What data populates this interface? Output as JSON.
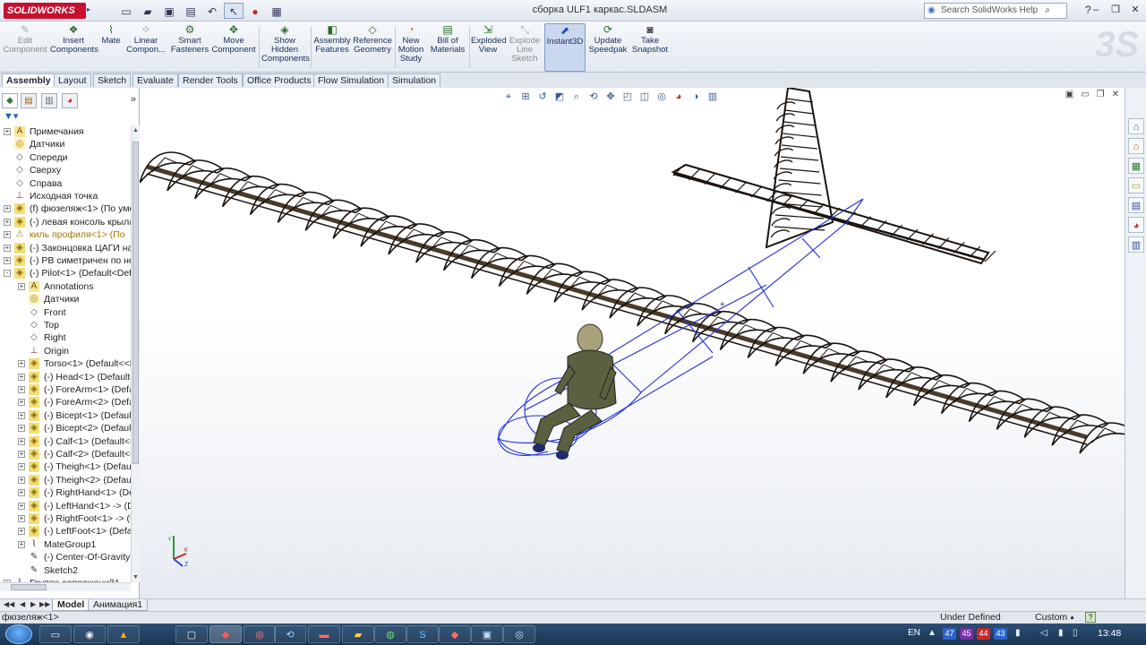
{
  "window": {
    "title": "сборка ULF1 каркас.SLDASM",
    "app_name": "SOLIDWORKS",
    "help_search_placeholder": "Search SolidWorks Help"
  },
  "ribbon": {
    "buttons": [
      {
        "label_1": "Edit",
        "label_2": "Component",
        "label_3": "",
        "disabled": true
      },
      {
        "label_1": "Insert",
        "label_2": "Components",
        "label_3": "",
        "disabled": false
      },
      {
        "label_1": "Mate",
        "label_2": "",
        "label_3": "",
        "disabled": false
      },
      {
        "label_1": "Linear",
        "label_2": "Compon...",
        "label_3": "",
        "disabled": false
      },
      {
        "label_1": "Smart",
        "label_2": "Fasteners",
        "label_3": "",
        "disabled": false
      },
      {
        "label_1": "Move",
        "label_2": "Component",
        "label_3": "",
        "disabled": false
      },
      {
        "label_1": "Show",
        "label_2": "Hidden",
        "label_3": "Components",
        "disabled": false
      },
      {
        "label_1": "Assembly",
        "label_2": "Features",
        "label_3": "",
        "disabled": false
      },
      {
        "label_1": "Reference",
        "label_2": "Geometry",
        "label_3": "",
        "disabled": false
      },
      {
        "label_1": "New",
        "label_2": "Motion",
        "label_3": "Study",
        "disabled": false
      },
      {
        "label_1": "Bill of",
        "label_2": "Materials",
        "label_3": "",
        "disabled": false
      },
      {
        "label_1": "Exploded",
        "label_2": "View",
        "label_3": "",
        "disabled": false
      },
      {
        "label_1": "Explode",
        "label_2": "Line",
        "label_3": "Sketch",
        "disabled": true
      },
      {
        "label_1": "Instant3D",
        "label_2": "",
        "label_3": "",
        "disabled": false
      },
      {
        "label_1": "Update",
        "label_2": "Speedpak",
        "label_3": "",
        "disabled": false
      },
      {
        "label_1": "Take",
        "label_2": "Snapshot",
        "label_3": "",
        "disabled": false
      }
    ]
  },
  "tabs": [
    "Assembly",
    "Layout",
    "Sketch",
    "Evaluate",
    "Render Tools",
    "Office Products",
    "Flow Simulation",
    "Simulation"
  ],
  "active_tab": "Assembly",
  "tree": {
    "items": [
      {
        "label": "Примечания",
        "icon": "annotations-icon",
        "indent": 0,
        "expander": "+",
        "warn": false
      },
      {
        "label": "Датчики",
        "icon": "sensor-icon",
        "indent": 0,
        "expander": "",
        "warn": false
      },
      {
        "label": "Спереди",
        "icon": "plane-icon",
        "indent": 0,
        "expander": "",
        "warn": false
      },
      {
        "label": "Сверху",
        "icon": "plane-icon",
        "indent": 0,
        "expander": "",
        "warn": false
      },
      {
        "label": "Справа",
        "icon": "plane-icon",
        "indent": 0,
        "expander": "",
        "warn": false
      },
      {
        "label": "Исходная точка",
        "icon": "origin-icon",
        "indent": 0,
        "expander": "",
        "warn": false
      },
      {
        "label": "(f) фюзеляж<1> (По умо",
        "icon": "part-icon",
        "indent": 0,
        "expander": "+",
        "warn": false
      },
      {
        "label": "(-) левая консоль крыла-",
        "icon": "part-icon",
        "indent": 0,
        "expander": "+",
        "warn": false
      },
      {
        "label": "киль профиля<1> (По",
        "icon": "warning-icon",
        "indent": 0,
        "expander": "+",
        "warn": true
      },
      {
        "label": "(-) Законцовка ЦАГИ на I",
        "icon": "part-icon",
        "indent": 0,
        "expander": "+",
        "warn": false
      },
      {
        "label": "(-) РВ симетричен по нер",
        "icon": "part-icon",
        "indent": 0,
        "expander": "+",
        "warn": false
      },
      {
        "label": "(-) Pilot<1> (Default<Defa",
        "icon": "assembly-icon",
        "indent": 0,
        "expander": "-",
        "warn": false
      },
      {
        "label": "Annotations",
        "icon": "annotations-icon",
        "indent": 1,
        "expander": "+",
        "warn": false
      },
      {
        "label": "Датчики",
        "icon": "sensor-icon",
        "indent": 1,
        "expander": "",
        "warn": false
      },
      {
        "label": "Front",
        "icon": "plane-icon",
        "indent": 1,
        "expander": "",
        "warn": false
      },
      {
        "label": "Top",
        "icon": "plane-icon",
        "indent": 1,
        "expander": "",
        "warn": false
      },
      {
        "label": "Right",
        "icon": "plane-icon",
        "indent": 1,
        "expander": "",
        "warn": false
      },
      {
        "label": "Origin",
        "icon": "origin-icon",
        "indent": 1,
        "expander": "",
        "warn": false
      },
      {
        "label": "Torso<1> (Default<<D",
        "icon": "part-icon",
        "indent": 1,
        "expander": "+",
        "warn": false
      },
      {
        "label": "(-) Head<1> (Default<",
        "icon": "part-icon",
        "indent": 1,
        "expander": "+",
        "warn": false
      },
      {
        "label": "(-) ForeArm<1> (Defau",
        "icon": "part-icon",
        "indent": 1,
        "expander": "+",
        "warn": false
      },
      {
        "label": "(-) ForeArm<2> (Defau",
        "icon": "part-icon",
        "indent": 1,
        "expander": "+",
        "warn": false
      },
      {
        "label": "(-) Bicept<1> (Default<",
        "icon": "part-icon",
        "indent": 1,
        "expander": "+",
        "warn": false
      },
      {
        "label": "(-) Bicept<2> (Default<",
        "icon": "part-icon",
        "indent": 1,
        "expander": "+",
        "warn": false
      },
      {
        "label": "(-) Calf<1> (Default<<",
        "icon": "part-icon",
        "indent": 1,
        "expander": "+",
        "warn": false
      },
      {
        "label": "(-) Calf<2> (Default<<",
        "icon": "part-icon",
        "indent": 1,
        "expander": "+",
        "warn": false
      },
      {
        "label": "(-) Theigh<1> (Default",
        "icon": "part-icon",
        "indent": 1,
        "expander": "+",
        "warn": false
      },
      {
        "label": "(-) Theigh<2> (Default",
        "icon": "part-icon",
        "indent": 1,
        "expander": "+",
        "warn": false
      },
      {
        "label": "(-) RightHand<1> (Def",
        "icon": "part-icon",
        "indent": 1,
        "expander": "+",
        "warn": false
      },
      {
        "label": "(-) LeftHand<1> -> (D",
        "icon": "part-icon",
        "indent": 1,
        "expander": "+",
        "warn": false
      },
      {
        "label": "(-) RightFoot<1> -> (D",
        "icon": "part-icon",
        "indent": 1,
        "expander": "+",
        "warn": false
      },
      {
        "label": "(-) LeftFoot<1> (Defau",
        "icon": "part-icon",
        "indent": 1,
        "expander": "+",
        "warn": false
      },
      {
        "label": "MateGroup1",
        "icon": "mates-icon",
        "indent": 1,
        "expander": "+",
        "warn": false
      },
      {
        "label": "(-) Center-Of-Gravity",
        "icon": "sketch-icon",
        "indent": 1,
        "expander": "",
        "warn": false
      },
      {
        "label": "Sketch2",
        "icon": "sketch-icon",
        "indent": 1,
        "expander": "",
        "warn": false
      },
      {
        "label": "Группа сопряжений1",
        "icon": "mates-icon",
        "indent": 0,
        "expander": "+",
        "warn": false
      }
    ]
  },
  "model_tabs": [
    "Model",
    "Анимация1"
  ],
  "active_model_tab": "Model",
  "status": {
    "selection": "фюзеляж<1>",
    "state": "Under Defined",
    "units": "Custom",
    "help": "?"
  },
  "taskbar": {
    "lang": "EN",
    "tray_numbers": [
      "47",
      "45",
      "44",
      "43"
    ],
    "tray_colors": [
      "#2b63c9",
      "#7a2fa6",
      "#c62828",
      "#2b63c9"
    ],
    "clock": "13:48"
  },
  "colors": {
    "wireframe_blue": "#1e2fd6",
    "structure": "#1b140f",
    "pilot_suit": "#5a6140",
    "accent": "#c8102e"
  }
}
